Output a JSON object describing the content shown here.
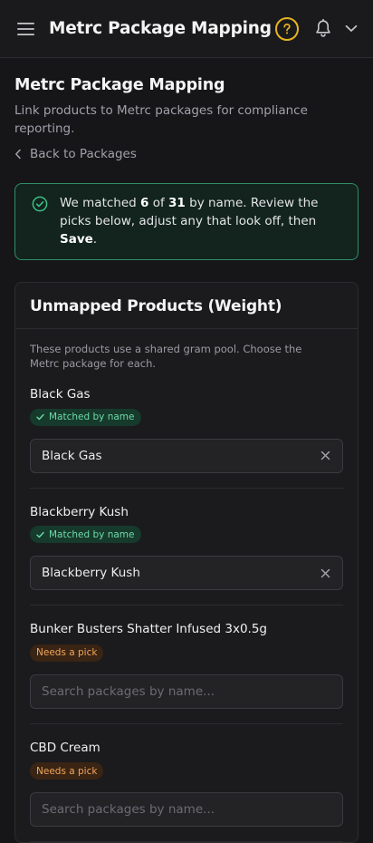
{
  "topbar": {
    "title": "Metrc Package Mapping",
    "icons": {
      "menu": "hamburger-menu-icon",
      "help": "help-circle-icon",
      "notifications": "bell-icon",
      "account": "chevron-down-icon"
    },
    "help_color": "#e6b422"
  },
  "header": {
    "title": "Metrc Package Mapping",
    "subtitle": "Link products to Metrc packages for compliance reporting.",
    "back_label": "Back to Packages"
  },
  "alert": {
    "prefix": "We matched ",
    "matched": "6",
    "of_text": " of ",
    "total": "31",
    "middle": " by name. Review the picks below, adjust any that look off, then ",
    "action": "Save",
    "suffix": ".",
    "color": "#2f8f68"
  },
  "card": {
    "title": "Unmapped Products (Weight)",
    "description": "These products use a shared gram pool. Choose the Metrc package for each.",
    "products": [
      {
        "name": "Black Gas",
        "status": "Matched by name",
        "status_type": "matched",
        "value": "Black Gas"
      },
      {
        "name": "Blackberry Kush",
        "status": "Matched by name",
        "status_type": "matched",
        "value": "Blackberry Kush"
      },
      {
        "name": "Bunker Busters Shatter Infused 3x0.5g",
        "status": "Needs a pick",
        "status_type": "needs",
        "value": "",
        "placeholder": "Search packages by name..."
      },
      {
        "name": "CBD Cream",
        "status": "Needs a pick",
        "status_type": "needs",
        "value": "",
        "placeholder": "Search packages by name..."
      }
    ]
  },
  "colors": {
    "matched_badge": "#6fd9a8",
    "needs_badge": "#f2a65a",
    "background": "#161618"
  }
}
